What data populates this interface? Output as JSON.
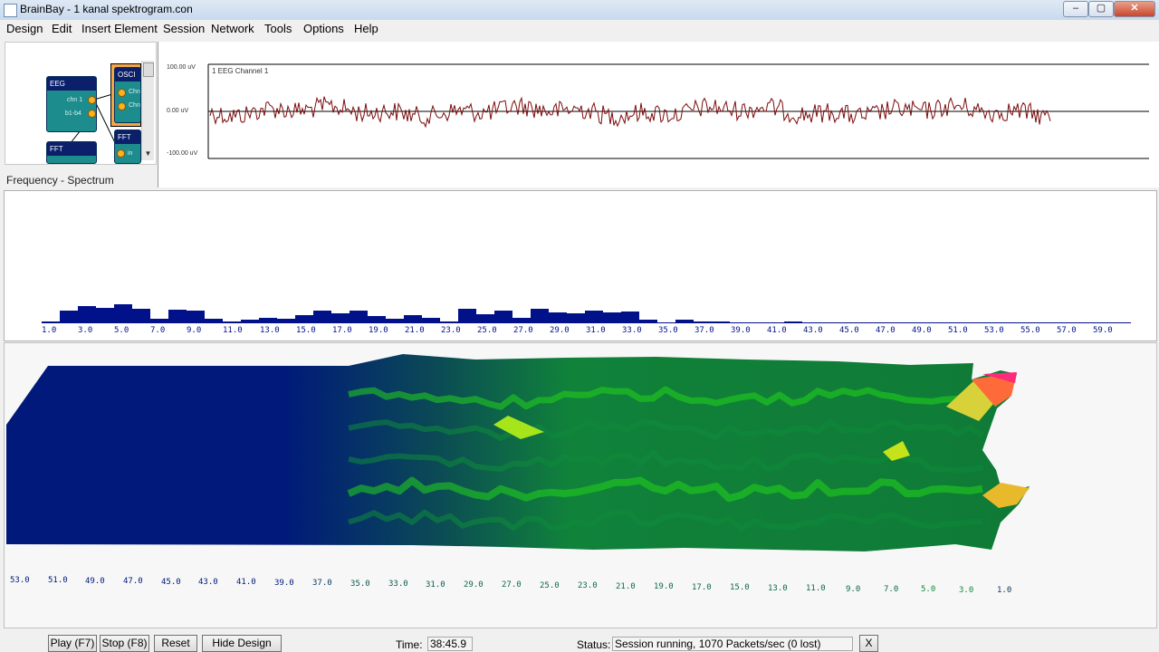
{
  "window": {
    "title": "BrainBay - 1 kanal spektrogram.con",
    "controls": [
      "–",
      "▢",
      "✕"
    ]
  },
  "menu": [
    "Design",
    "Edit",
    "Insert Element",
    "Session",
    "Network",
    "Tools",
    "Options",
    "Help"
  ],
  "design": {
    "nodes": [
      {
        "title": "EEG",
        "ports": [
          "chn 1",
          "b1-b4"
        ]
      },
      {
        "title": "OSCI",
        "ports": [
          "Chn",
          "Chn"
        ]
      },
      {
        "title": "FFT",
        "ports": [
          "in"
        ]
      },
      {
        "title": "FFT",
        "ports": []
      }
    ]
  },
  "oscilloscope": {
    "channel_label": "1 EEG Channel 1",
    "y_labels": [
      "100.00 uV",
      "0.00 uV",
      "-100.00 uV"
    ],
    "colors": {
      "trace": "#7a0a0a",
      "axis": "#000000"
    }
  },
  "spectrum": {
    "title": "Frequency - Spectrum",
    "bar_color": "#00118a",
    "ticks": [
      "1.0",
      "3.0",
      "5.0",
      "7.0",
      "9.0",
      "11.0",
      "13.0",
      "15.0",
      "17.0",
      "19.0",
      "21.0",
      "23.0",
      "25.0",
      "27.0",
      "29.0",
      "31.0",
      "33.0",
      "35.0",
      "37.0",
      "39.0",
      "41.0",
      "43.0",
      "45.0",
      "47.0",
      "49.0",
      "51.0",
      "53.0",
      "55.0",
      "57.0",
      "59.0"
    ],
    "levels": [
      2,
      14,
      19,
      17,
      21,
      16,
      5,
      15,
      14,
      5,
      2,
      4,
      6,
      5,
      9,
      14,
      11,
      14,
      8,
      5,
      9,
      6,
      2,
      16,
      10,
      14,
      6,
      16,
      12,
      11,
      14,
      12,
      13,
      4,
      1,
      4,
      2,
      2,
      1,
      0,
      1,
      2,
      0,
      0,
      0,
      0,
      0,
      0,
      0,
      0,
      0,
      0,
      0,
      0,
      0,
      0,
      0,
      0,
      0,
      0
    ]
  },
  "spectrogram": {
    "ticks": [
      "53.0",
      "51.0",
      "49.0",
      "47.0",
      "45.0",
      "43.0",
      "41.0",
      "39.0",
      "37.0",
      "35.0",
      "33.0",
      "31.0",
      "29.0",
      "27.0",
      "25.0",
      "23.0",
      "21.0",
      "19.0",
      "17.0",
      "15.0",
      "13.0",
      "11.0",
      "9.0",
      "7.0",
      "5.0",
      "3.0",
      "1.0"
    ],
    "colors": {
      "low": "#00197a",
      "mid": "#0f8a3a",
      "high": "#22d41a",
      "peak": "#ff2a7a"
    }
  },
  "controls": {
    "play": "Play (F7)",
    "stop": "Stop (F8)",
    "reset": "Reset",
    "hide_design": "Hide Design",
    "time_label": "Time:",
    "time_value": "38:45.9",
    "status_label": "Status:",
    "status_value": "Session running,  1070 Packets/sec (0 lost)",
    "close": "X"
  }
}
